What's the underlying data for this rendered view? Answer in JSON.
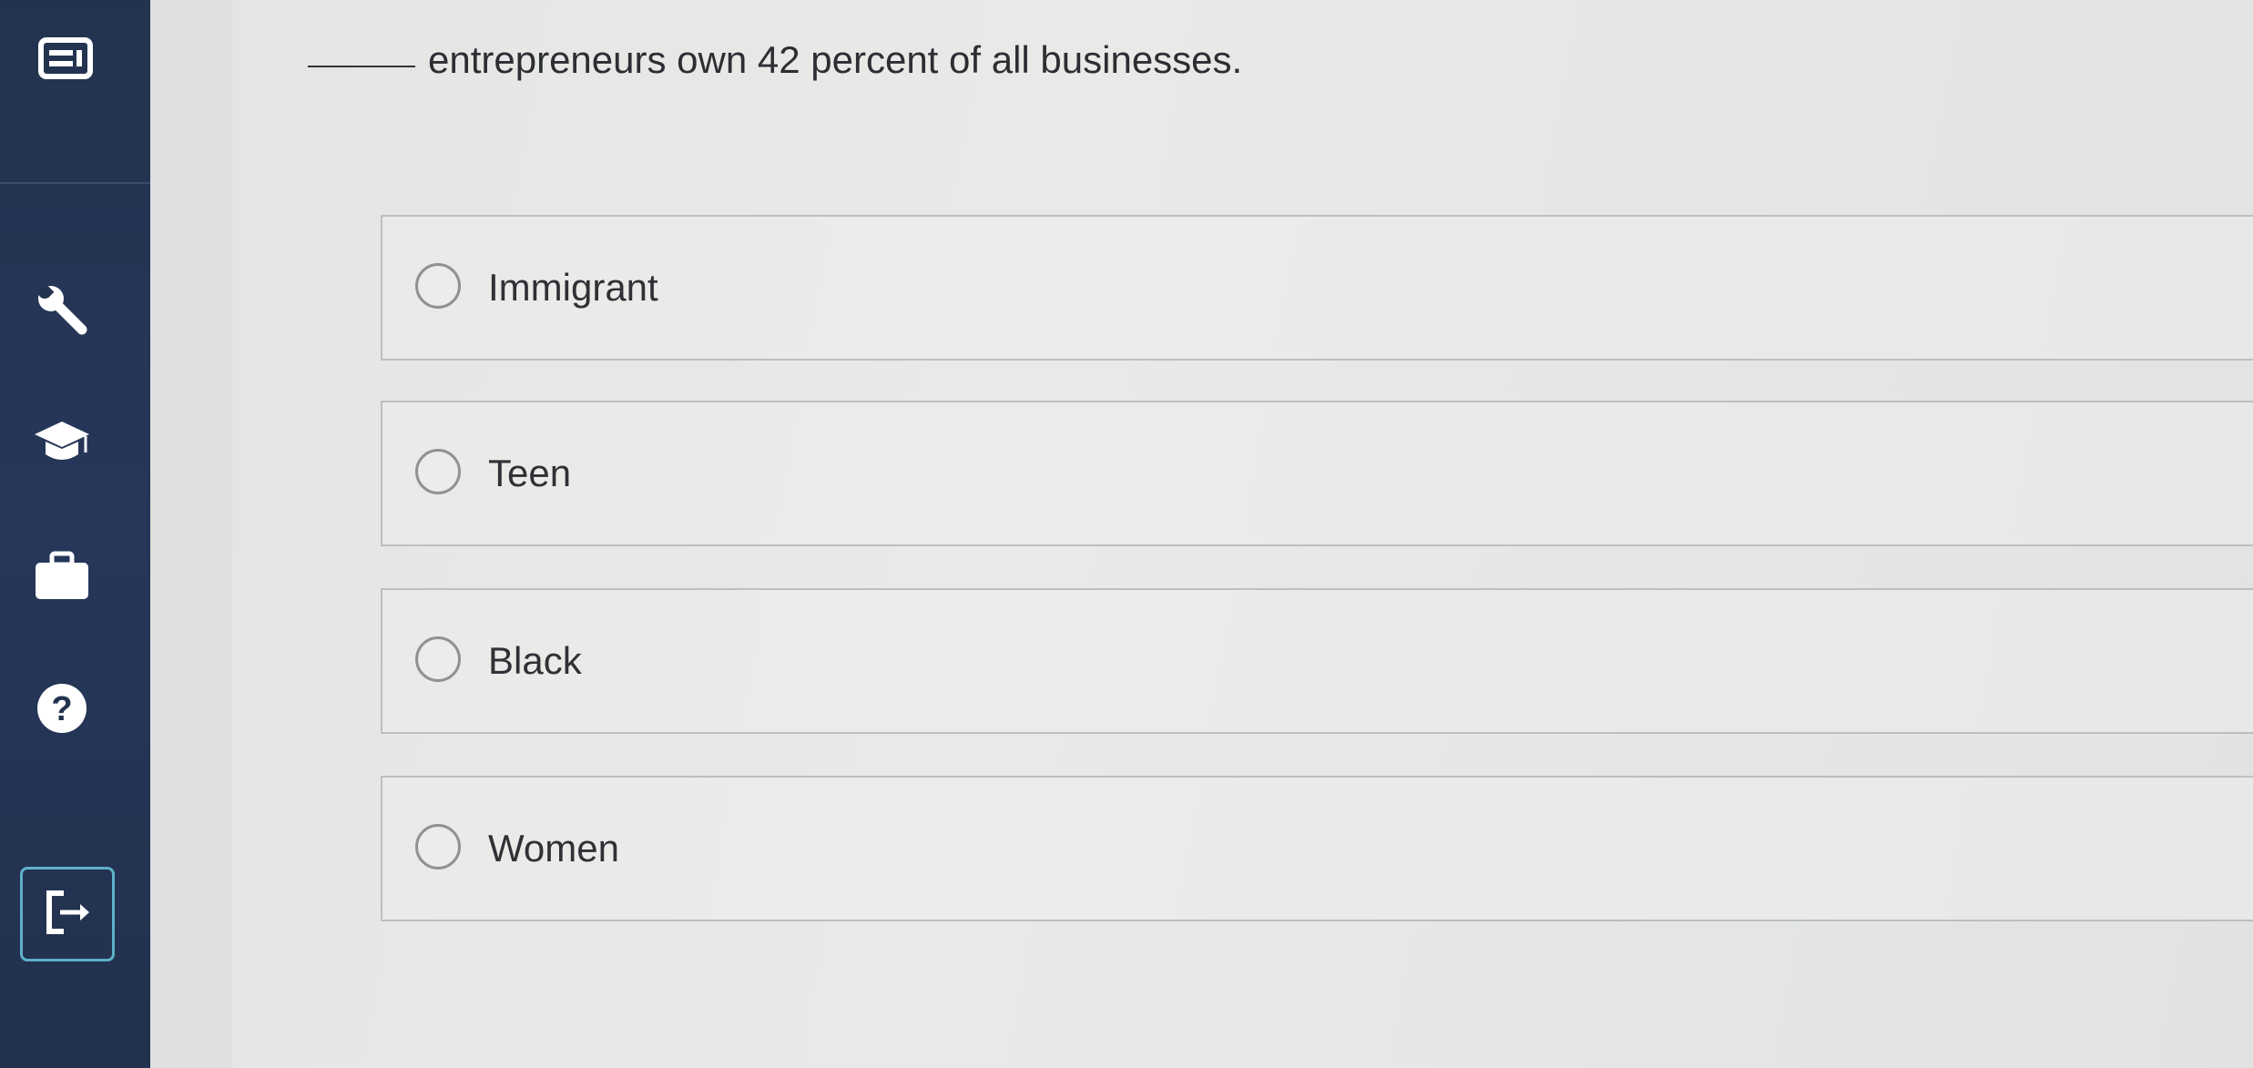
{
  "sidebar": {
    "icons": [
      "menu-list-icon",
      "wrench-icon",
      "graduation-cap-icon",
      "briefcase-icon",
      "help-icon",
      "exit-icon"
    ]
  },
  "question": {
    "text": "entrepreneurs own 42 percent of all businesses."
  },
  "options": [
    {
      "label": "Immigrant",
      "selected": false
    },
    {
      "label": "Teen",
      "selected": false
    },
    {
      "label": "Black",
      "selected": false
    },
    {
      "label": "Women",
      "selected": false
    }
  ],
  "colors": {
    "sidebar": "#23334f",
    "exit_border": "#5fb0c9",
    "icon": "#ffffff"
  }
}
